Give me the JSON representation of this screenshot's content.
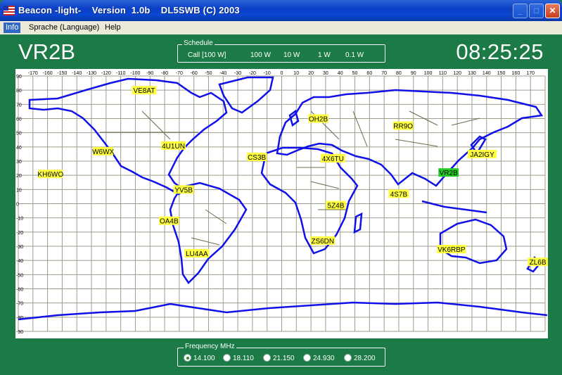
{
  "window": {
    "title": "Beacon -light-    Version  1.0b    DL5SWB (C) 2003",
    "buttons": {
      "minimize": "_",
      "maximize": "□",
      "close": "✕"
    }
  },
  "menu": [
    {
      "id": "info",
      "label": "Info",
      "active": true
    },
    {
      "id": "sprache",
      "label": "Sprache (Language)",
      "active": false
    },
    {
      "id": "help",
      "label": "Help",
      "active": false
    }
  ],
  "current_beacon": "VR2B",
  "clock": "08:25:25",
  "schedule": {
    "legend": "Schedule",
    "items": [
      "Call [100 W]",
      "100 W",
      "10 W",
      "1 W",
      "0.1 W"
    ]
  },
  "map": {
    "longitude_labels": [
      "-170",
      "-160",
      "-150",
      "-140",
      "-130",
      "-120",
      "-110",
      "-100",
      "-90",
      "-80",
      "-70",
      "-60",
      "-50",
      "-40",
      "-30",
      "-20",
      "-10",
      "0",
      "10",
      "20",
      "30",
      "40",
      "50",
      "60",
      "70",
      "80",
      "90",
      "100",
      "110",
      "120",
      "130",
      "140",
      "150",
      "160",
      "170"
    ],
    "latitude_labels": [
      "90",
      "80",
      "70",
      "60",
      "50",
      "40",
      "30",
      "20",
      "10",
      "0",
      "-10",
      "-20",
      "-30",
      "-40",
      "-50",
      "-60",
      "-70",
      "-80",
      "-90"
    ],
    "colors": {
      "coast": "#1010e8",
      "border": "#6b6b4e",
      "grid": "#9c9c8c",
      "beacon_label": "#ffff40",
      "active_beacon": "#22cc22"
    },
    "beacons": [
      {
        "call": "VE8AT",
        "lon": -94,
        "lat": 80,
        "active": false
      },
      {
        "call": "OH2B",
        "lon": 25,
        "lat": 60,
        "active": false
      },
      {
        "call": "RR9O",
        "lon": 83,
        "lat": 55,
        "active": false
      },
      {
        "call": "W6WX",
        "lon": -122,
        "lat": 37,
        "active": false
      },
      {
        "call": "4U1UN",
        "lon": -74,
        "lat": 41,
        "active": false
      },
      {
        "call": "CS3B",
        "lon": -17,
        "lat": 33,
        "active": false
      },
      {
        "call": "4X6TU",
        "lon": 35,
        "lat": 32,
        "active": false
      },
      {
        "call": "VR2B",
        "lon": 114,
        "lat": 22,
        "active": true
      },
      {
        "call": "JA2IGY",
        "lon": 137,
        "lat": 35,
        "active": false
      },
      {
        "call": "KH6WO",
        "lon": -158,
        "lat": 21,
        "active": false
      },
      {
        "call": "YV5B",
        "lon": -67,
        "lat": 10,
        "active": false
      },
      {
        "call": "4S7B",
        "lon": 80,
        "lat": 7,
        "active": false
      },
      {
        "call": "5Z4B",
        "lon": 37,
        "lat": -1,
        "active": false
      },
      {
        "call": "OA4B",
        "lon": -77,
        "lat": -12,
        "active": false
      },
      {
        "call": "ZS6DN",
        "lon": 28,
        "lat": -26,
        "active": false
      },
      {
        "call": "LU4AA",
        "lon": -58,
        "lat": -35,
        "active": false
      },
      {
        "call": "VK6RBP",
        "lon": 116,
        "lat": -32,
        "active": false
      },
      {
        "call": "ZL6B",
        "lon": 175,
        "lat": -41,
        "active": false
      }
    ]
  },
  "frequency": {
    "legend": "Frequency MHz",
    "options": [
      {
        "label": "14.100",
        "selected": true
      },
      {
        "label": "18.110",
        "selected": false
      },
      {
        "label": "21.150",
        "selected": false
      },
      {
        "label": "24.930",
        "selected": false
      },
      {
        "label": "28.200",
        "selected": false
      }
    ]
  }
}
